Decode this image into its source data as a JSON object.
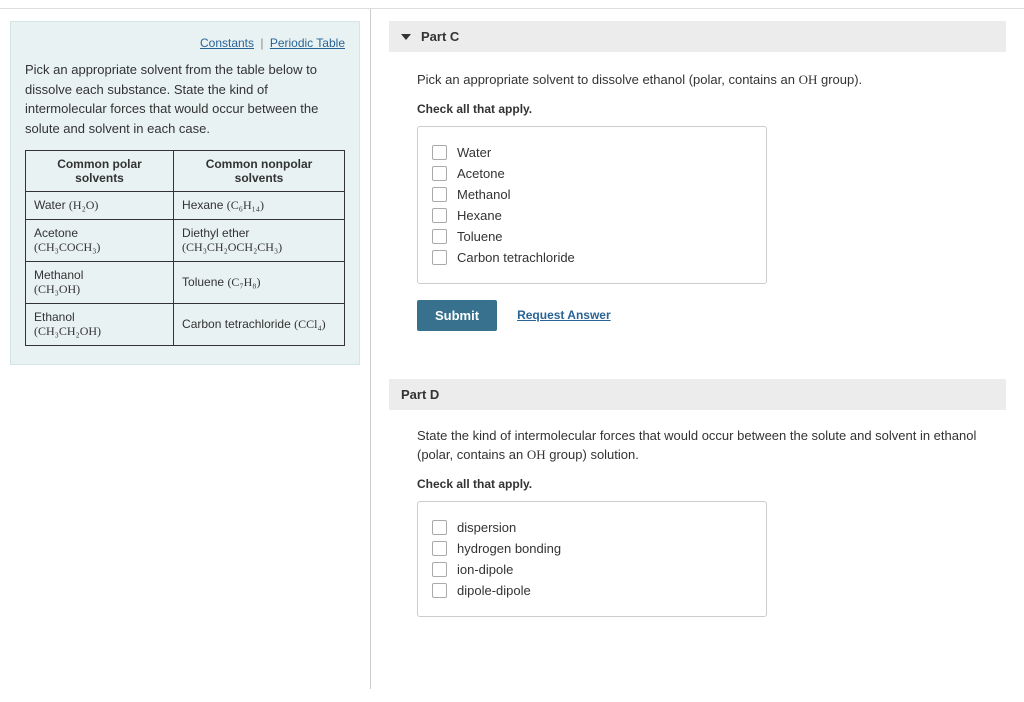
{
  "links": {
    "constants": "Constants",
    "periodic": "Periodic Table"
  },
  "intro": "Pick an appropriate solvent from the table below to dissolve each substance. State the kind of intermolecular forces that would occur between the solute and solvent in each case.",
  "table": {
    "head_polar": "Common polar solvents",
    "head_nonpolar": "Common nonpolar solvents",
    "rows": [
      {
        "p_name": "Water",
        "p_formula": "(H₂O)",
        "n_name": "Hexane",
        "n_formula": "(C₆H₁₄)"
      },
      {
        "p_name": "Acetone",
        "p_formula": "(CH₃COCH₃)",
        "n_name": "Diethyl ether",
        "n_formula": "(CH₃CH₂OCH₂CH₃)"
      },
      {
        "p_name": "Methanol",
        "p_formula": "(CH₃OH)",
        "n_name": "Toluene",
        "n_formula": "(C₇H₈)"
      },
      {
        "p_name": "Ethanol",
        "p_formula": "(CH₃CH₂OH)",
        "n_name": "Carbon tetrachloride",
        "n_formula": "(CCl₄)"
      }
    ]
  },
  "partC": {
    "title": "Part C",
    "question_pre": "Pick an appropriate solvent to dissolve ethanol (polar, contains an ",
    "question_oh": "OH",
    "question_post": " group).",
    "check": "Check all that apply.",
    "options": [
      "Water",
      "Acetone",
      "Methanol",
      "Hexane",
      "Toluene",
      "Carbon tetrachloride"
    ],
    "submit": "Submit",
    "request": "Request Answer"
  },
  "partD": {
    "title": "Part D",
    "question_pre": "State the kind of intermolecular forces that would occur between the solute and solvent in ethanol (polar, contains an ",
    "question_oh": "OH",
    "question_post": " group) solution.",
    "check": "Check all that apply.",
    "options": [
      "dispersion",
      "hydrogen bonding",
      "ion-dipole",
      "dipole-dipole"
    ]
  }
}
